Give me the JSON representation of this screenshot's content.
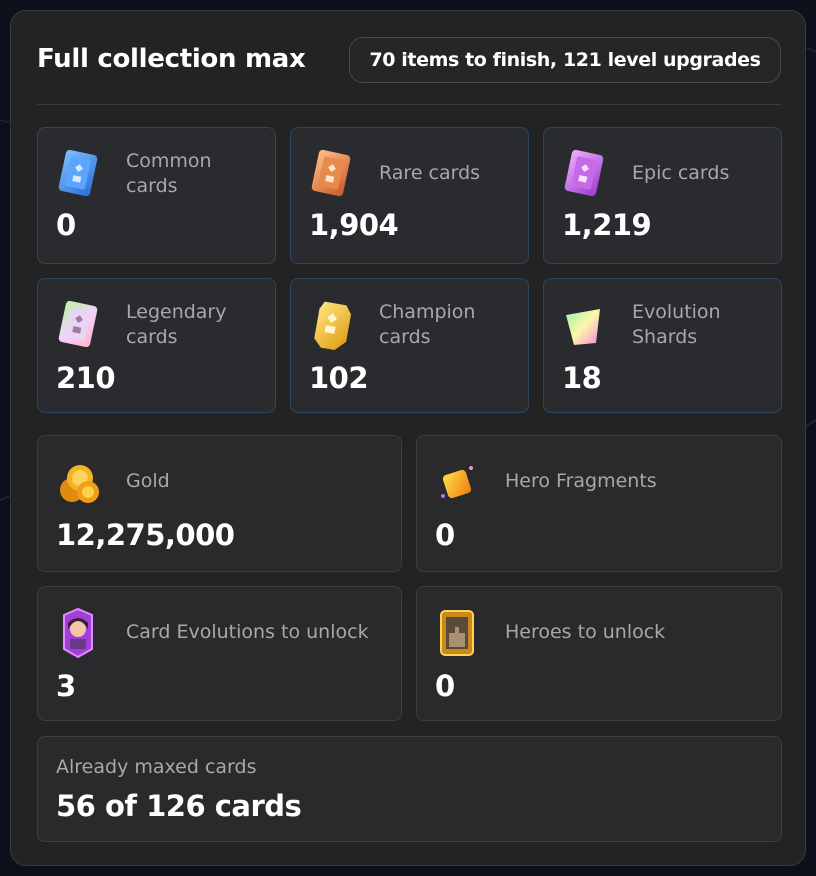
{
  "header": {
    "title": "Full collection max",
    "summary": "70 items to finish, 121 level upgrades"
  },
  "items": [
    {
      "label": "Common cards",
      "value": "0",
      "icon": "common-card-icon"
    },
    {
      "label": "Rare cards",
      "value": "1,904",
      "icon": "rare-card-icon"
    },
    {
      "label": "Epic cards",
      "value": "1,219",
      "icon": "epic-card-icon"
    },
    {
      "label": "Legendary cards",
      "value": "210",
      "icon": "legendary-card-icon"
    },
    {
      "label": "Champion cards",
      "value": "102",
      "icon": "champion-card-icon"
    },
    {
      "label": "Evolution Shards",
      "value": "18",
      "icon": "evolution-shard-icon"
    }
  ],
  "resources": [
    {
      "label": "Gold",
      "value": "12,275,000",
      "icon": "gold-coins-icon"
    },
    {
      "label": "Hero Fragments",
      "value": "0",
      "icon": "hero-fragment-icon"
    },
    {
      "label": "Card Evolutions to unlock",
      "value": "3",
      "icon": "card-evolution-icon"
    },
    {
      "label": "Heroes to unlock",
      "value": "0",
      "icon": "hero-card-icon"
    }
  ],
  "maxed": {
    "label": "Already maxed cards",
    "value": "56 of 126 cards"
  },
  "colors": {
    "panel": "#232323",
    "common": "#3d8cf0",
    "rare": "#e07a3c",
    "epic": "#c35ee8",
    "champion": "#f2b320",
    "gold": "#f5a623"
  }
}
